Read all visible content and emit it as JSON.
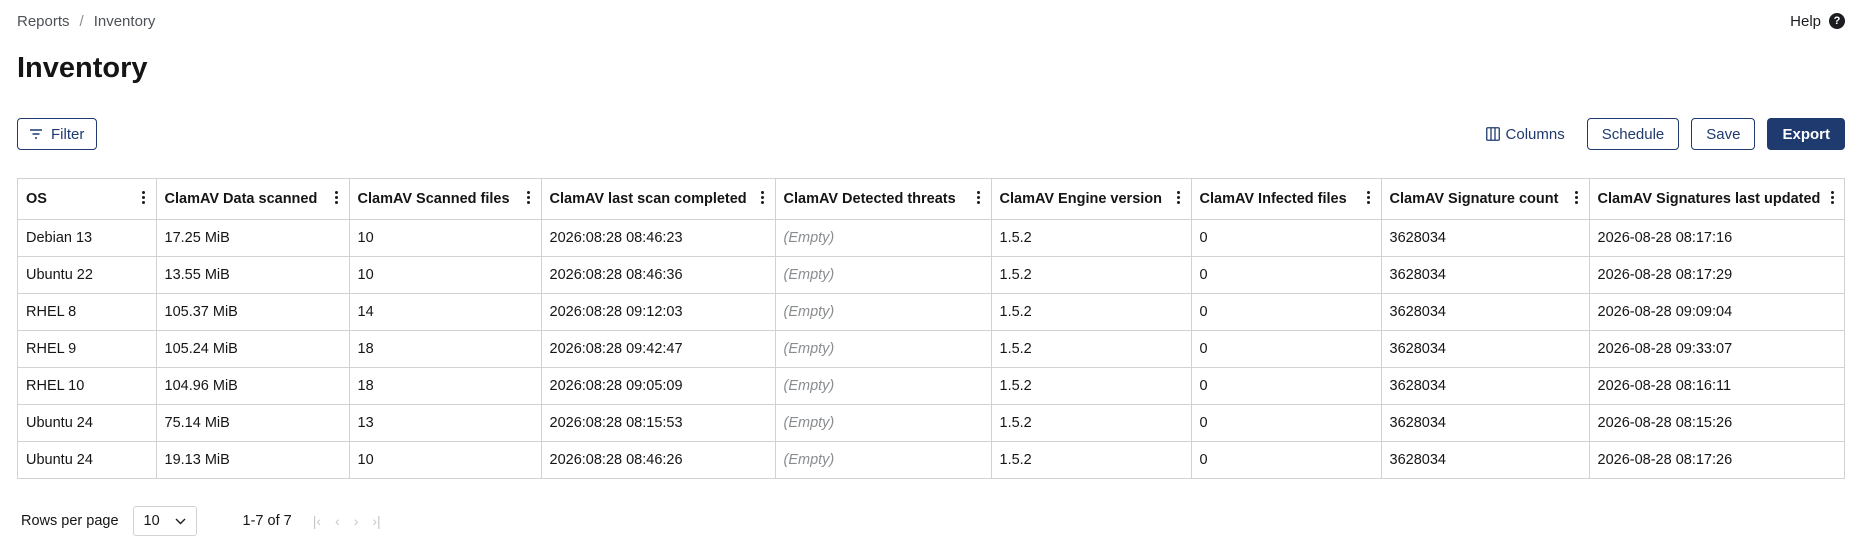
{
  "breadcrumb": {
    "items": [
      "Reports",
      "Inventory"
    ],
    "separator": "/"
  },
  "help": {
    "label": "Help",
    "icon": "question-circle-icon"
  },
  "page": {
    "title": "Inventory"
  },
  "toolbar": {
    "filter_label": "Filter",
    "columns_label": "Columns",
    "schedule_label": "Schedule",
    "save_label": "Save",
    "export_label": "Export"
  },
  "colors": {
    "primary": "#1f3a6e",
    "border": "#d2d2d2",
    "muted": "#8a8d90"
  },
  "table": {
    "columns": [
      "OS",
      "ClamAV Data scanned",
      "ClamAV Scanned files",
      "ClamAV last scan completed",
      "ClamAV Detected threats",
      "ClamAV Engine version",
      "ClamAV Infected files",
      "ClamAV Signature count",
      "ClamAV Signatures last updated"
    ],
    "rows": [
      [
        "Debian 13",
        "17.25 MiB",
        "10",
        "2026:08:28 08:46:23",
        "(Empty)",
        "1.5.2",
        "0",
        "3628034",
        "2026-08-28 08:17:16"
      ],
      [
        "Ubuntu 22",
        "13.55 MiB",
        "10",
        "2026:08:28 08:46:36",
        "(Empty)",
        "1.5.2",
        "0",
        "3628034",
        "2026-08-28 08:17:29"
      ],
      [
        "RHEL 8",
        "105.37 MiB",
        "14",
        "2026:08:28 09:12:03",
        "(Empty)",
        "1.5.2",
        "0",
        "3628034",
        "2026-08-28 09:09:04"
      ],
      [
        "RHEL 9",
        "105.24 MiB",
        "18",
        "2026:08:28 09:42:47",
        "(Empty)",
        "1.5.2",
        "0",
        "3628034",
        "2026-08-28 09:33:07"
      ],
      [
        "RHEL 10",
        "104.96 MiB",
        "18",
        "2026:08:28 09:05:09",
        "(Empty)",
        "1.5.2",
        "0",
        "3628034",
        "2026-08-28 08:16:11"
      ],
      [
        "Ubuntu 24",
        "75.14 MiB",
        "13",
        "2026:08:28 08:15:53",
        "(Empty)",
        "1.5.2",
        "0",
        "3628034",
        "2026-08-28 08:15:26"
      ],
      [
        "Ubuntu 24",
        "19.13 MiB",
        "10",
        "2026:08:28 08:46:26",
        "(Empty)",
        "1.5.2",
        "0",
        "3628034",
        "2026-08-28 08:17:26"
      ]
    ]
  },
  "pagination": {
    "rows_per_page_label": "Rows per page",
    "per_page_value": "10",
    "range_label": "1-7 of 7"
  }
}
